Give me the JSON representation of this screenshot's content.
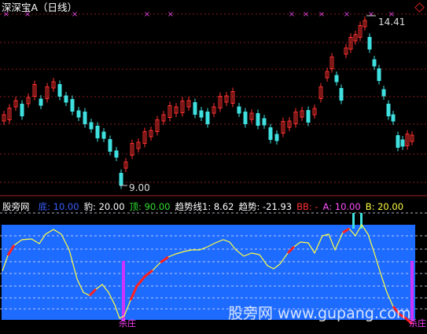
{
  "chart_title": "深深宝A（日线）",
  "top_marker_price": "14.41",
  "bottom_marker_price": "9.00",
  "indicator": {
    "name": "股旁网",
    "items": [
      {
        "label": "底: ",
        "value": "10.00",
        "color": "#3a5fff"
      },
      {
        "label": "豹: ",
        "value": "20.00",
        "color": "#ffffff"
      },
      {
        "label": "顶: ",
        "value": "90.00",
        "color": "#30e030"
      },
      {
        "label": "趋势线1: ",
        "value": "8.62",
        "color": "#ffffff"
      },
      {
        "label": "趋势: ",
        "value": "-21.93",
        "color": "#ffffff"
      },
      {
        "label": "BB: ",
        "value": "-",
        "color": "#ff3030"
      },
      {
        "label": "A: ",
        "value": "10.00",
        "color": "#ff50ff"
      },
      {
        "label": "B: ",
        "value": "20.00",
        "color": "#ffff40"
      }
    ]
  },
  "signal_label_left": "杀庄",
  "signal_label_right": "杀庄",
  "watermark": "股旁网 www.gupang.com",
  "colors": {
    "up": "#ff3030",
    "down": "#40e0e0",
    "band": "#1e6bff",
    "osc": "#ffff40",
    "signal": "#cc33ff"
  }
}
